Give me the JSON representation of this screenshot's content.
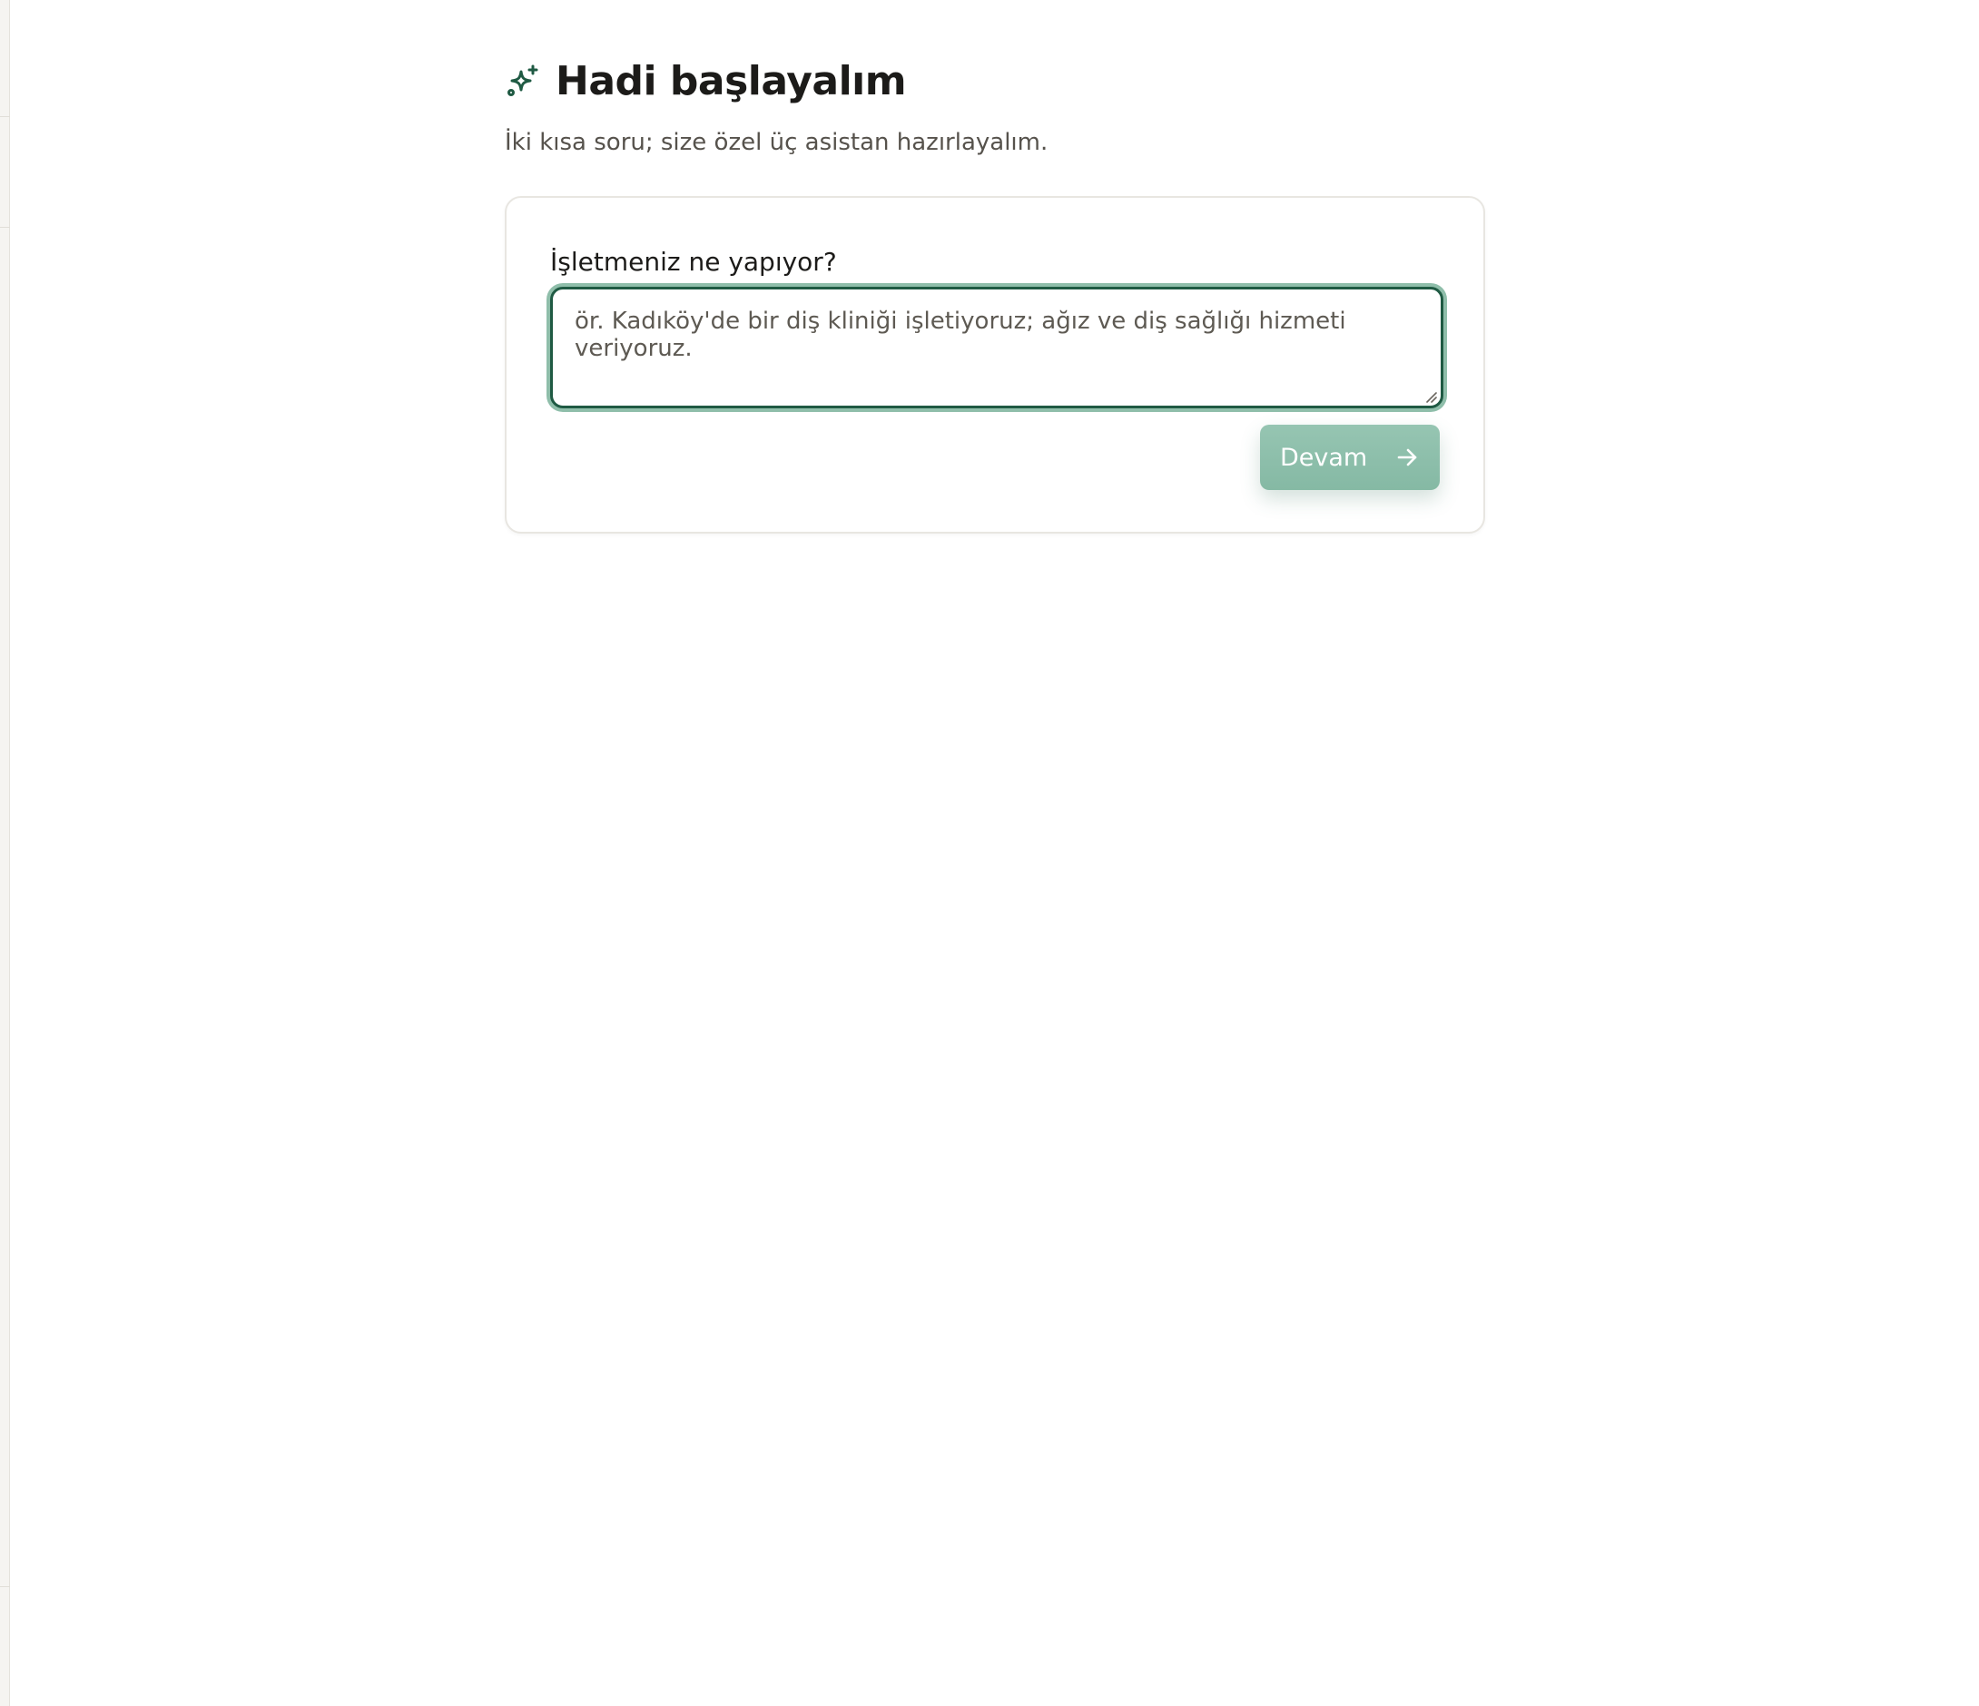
{
  "onboarding": {
    "title": "Hadi başlayalım",
    "subtitle": "İki kısa soru; size özel üç asistan hazırlayalım.",
    "question": {
      "label": "İşletmeniz ne yapıyor?",
      "value": "",
      "placeholder": "ör. Kadıköy'de bir diş kliniği işletiyoruz; ağız ve diş sağlığı hizmeti veriyoruz."
    },
    "continue_label": "Devam"
  },
  "icons": {
    "heading": "sparkles-icon",
    "continue": "arrow-right-icon"
  },
  "colors": {
    "accent": "#1f5a43",
    "button": "#8dbfab",
    "focus_ring": "#8fbeaa"
  }
}
